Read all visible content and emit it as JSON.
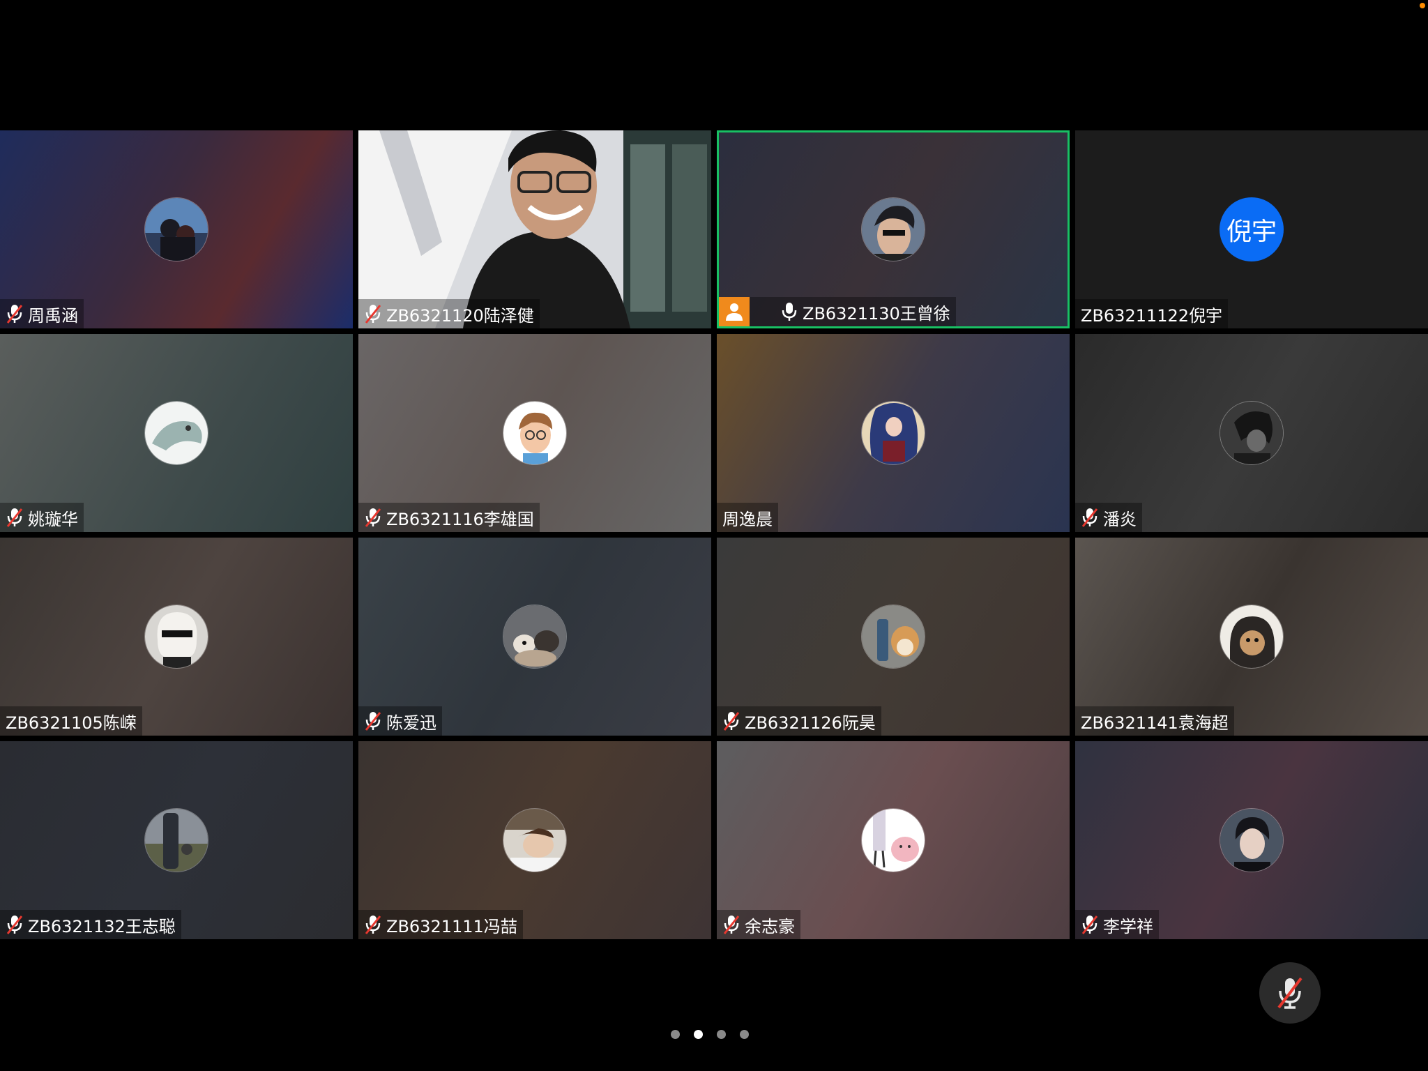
{
  "participants": [
    {
      "name": "周禹涵",
      "muted": true,
      "bg": "linear-gradient(120deg,#1f2c5c 0%,#3b2a3e 45%,#5a2a2f 70%,#1b2d6a 100%)",
      "avatar": "photo"
    },
    {
      "name": "ZB6321120陆泽健",
      "muted": true,
      "video": true
    },
    {
      "name": "ZB6321130王曾徐",
      "muted": false,
      "active": true,
      "host": true,
      "bg": "linear-gradient(120deg,#2b2e3e 0%,#3a3138 50%,#2a3446 100%)",
      "avatar": "photo"
    },
    {
      "name": "ZB63211122倪宇",
      "muted": null,
      "bg": "#1c1c1c",
      "avatar_text": "倪宇"
    },
    {
      "name": "姚璇华",
      "muted": true,
      "bg": "linear-gradient(120deg,#5a5e5c 0%,#3e4a4a 60%,#2f3f40 100%)",
      "avatar": "photo"
    },
    {
      "name": "ZB6321116李雄国",
      "muted": true,
      "bg": "linear-gradient(120deg,#6a6666 0%,#5e5552 50%,#676767 100%)",
      "avatar": "photo"
    },
    {
      "name": "周逸晨",
      "muted": null,
      "bg": "linear-gradient(120deg,#6a4f2a 0%,#3e3a48 50%,#2a3450 100%)",
      "avatar": "photo"
    },
    {
      "name": "潘炎",
      "muted": true,
      "bg": "linear-gradient(120deg,#2a2a2a 0%,#3a3a3a 50%,#2b2b2b 100%)",
      "avatar": "photo"
    },
    {
      "name": "ZB6321105陈嵘",
      "muted": null,
      "bg": "linear-gradient(120deg,#3a3532 0%,#4e4440 50%,#3b3230 100%)",
      "avatar": "photo"
    },
    {
      "name": "陈爱迅",
      "muted": true,
      "bg": "linear-gradient(120deg,#3a4248 0%,#2f353c 50%,#3b3d45 100%)",
      "avatar": "photo"
    },
    {
      "name": "ZB6321126阮昊",
      "muted": true,
      "bg": "linear-gradient(120deg,#3a3a3a 0%,#423b35 50%,#3e3430 100%)",
      "avatar": "photo"
    },
    {
      "name": "ZB6321141袁海超",
      "muted": null,
      "bg": "linear-gradient(120deg,#5b5550 0%,#3a3430 50%,#564d47 100%)",
      "avatar": "photo"
    },
    {
      "name": "ZB6321132王志聪",
      "muted": true,
      "bg": "linear-gradient(120deg,#2a2c32 0%,#2d3038 50%,#2b2c30 100%)",
      "avatar": "photo"
    },
    {
      "name": "ZB6321111冯喆",
      "muted": true,
      "bg": "linear-gradient(120deg,#3a3330 0%,#4a3a30 50%,#3e3434 100%)",
      "avatar": "photo"
    },
    {
      "name": "余志豪",
      "muted": true,
      "bg": "linear-gradient(120deg,#5d5d5f 0%,#6a4e50 50%,#4e3e42 100%)",
      "avatar": "photo"
    },
    {
      "name": "李学祥",
      "muted": true,
      "bg": "linear-gradient(120deg,#2f3240 0%,#4a3440 50%,#2b2f3c 100%)",
      "avatar": "photo"
    }
  ],
  "pager": {
    "count": 4,
    "active": 1
  },
  "colors": {
    "active_border": "#19c064",
    "host_badge": "#f08a1c",
    "avatar_blue": "#0a6cf5",
    "mute_red": "#e8382f"
  }
}
